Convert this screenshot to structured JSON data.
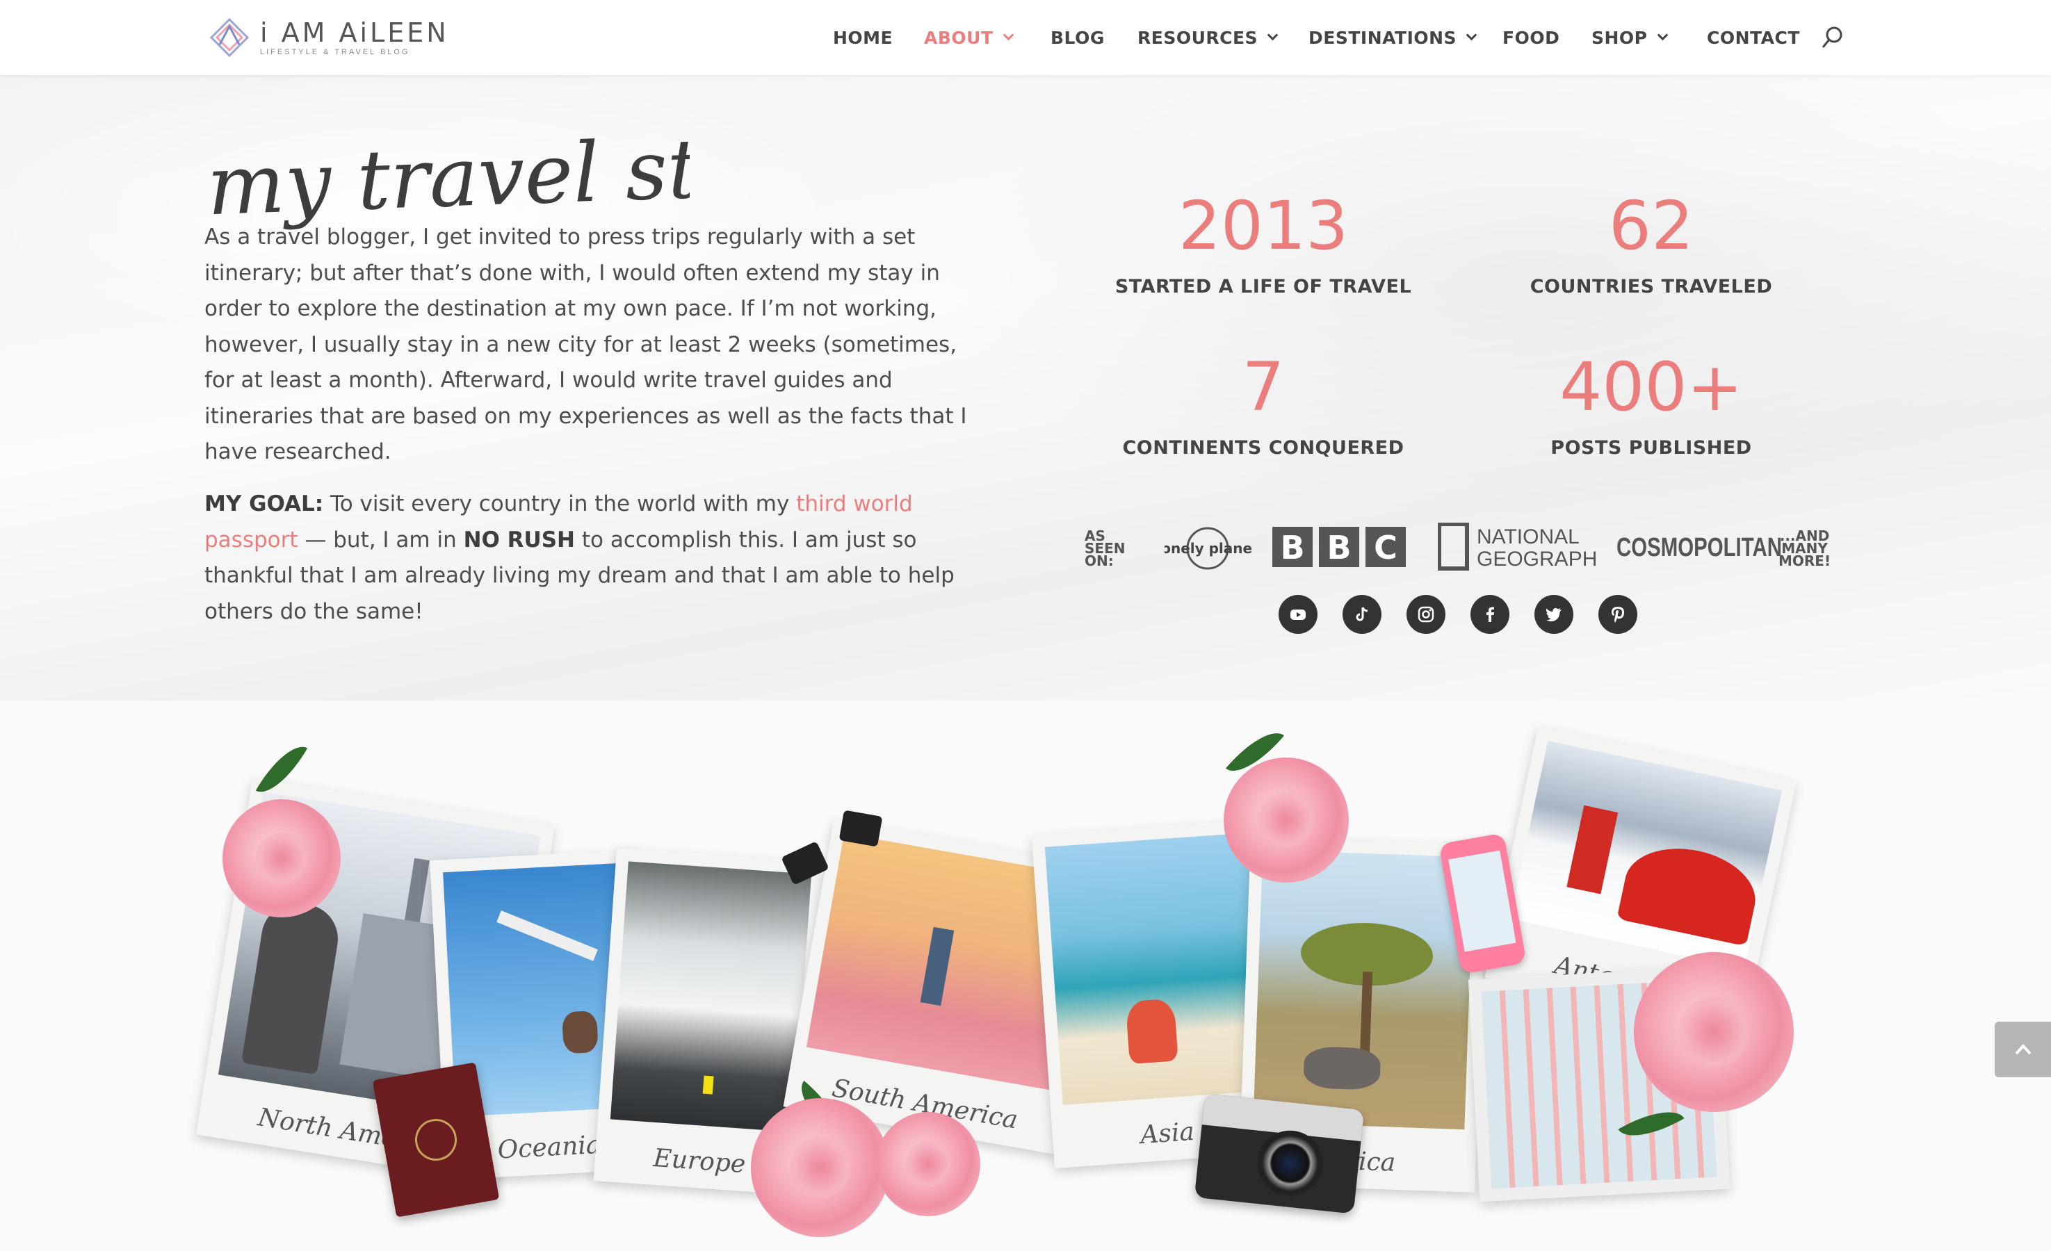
{
  "brand": {
    "name": "i AM AiLEEN",
    "tagline": "LIFESTYLE & TRAVEL BLOG"
  },
  "nav": {
    "items": [
      {
        "label": "HOME",
        "dropdown": false,
        "active": false
      },
      {
        "label": "ABOUT",
        "dropdown": true,
        "active": true
      },
      {
        "label": "BLOG",
        "dropdown": false,
        "active": false
      },
      {
        "label": "RESOURCES",
        "dropdown": true,
        "active": false
      },
      {
        "label": "DESTINATIONS",
        "dropdown": true,
        "active": false
      },
      {
        "label": "FOOD",
        "dropdown": false,
        "active": false
      },
      {
        "label": "SHOP",
        "dropdown": true,
        "active": false
      },
      {
        "label": "CONTACT",
        "dropdown": false,
        "active": false
      }
    ],
    "search_icon": "search-icon"
  },
  "intro": {
    "script_title": "my travel style",
    "body": "As a travel blogger, I get invited to press trips regularly with a set itinerary; but after that’s done with, I would often extend my stay in order to explore the destination at my own pace. If I’m not working, however, I usually stay in a new city for at least 2 weeks (sometimes, for at least a month). Afterward, I would write travel guides and itineraries that are based on my experiences as well as the facts that I have researched.",
    "goal_label": "MY GOAL:",
    "goal_text_1": " To visit every country in the world with my ",
    "goal_link": "third world passport",
    "goal_text_2": " — but, I am in ",
    "goal_bold": "NO RUSH",
    "goal_text_3": " to accomplish this. I am just so thankful that I am already living my dream and that I am able to help others do the same!"
  },
  "stats": [
    {
      "number": "2013",
      "label": "STARTED A LIFE OF TRAVEL"
    },
    {
      "number": "62",
      "label": "COUNTRIES TRAVELED"
    },
    {
      "number": "7",
      "label": "CONTINENTS CONQUERED"
    },
    {
      "number": "400+",
      "label": "POSTS PUBLISHED"
    }
  ],
  "as_seen_on": {
    "label_lines": [
      "AS",
      "SEEN",
      "ON:"
    ],
    "publications": [
      "lonely planet",
      "BBC",
      "NATIONAL GEOGRAPHIC",
      "COSMOPOLITAN"
    ],
    "more_lines": [
      "...AND",
      "MANY",
      "MORE!"
    ]
  },
  "social": [
    "youtube-icon",
    "tiktok-icon",
    "instagram-icon",
    "facebook-icon",
    "twitter-icon",
    "pinterest-icon"
  ],
  "collage": {
    "captions": [
      "North America",
      "Oceania",
      "Europe",
      "South America",
      "Asia",
      "Africa",
      "Antarctica"
    ]
  },
  "colors": {
    "accent": "#ec7d7d",
    "text": "#4d4d4d",
    "nav": "#444444",
    "social_bg": "#333333"
  }
}
